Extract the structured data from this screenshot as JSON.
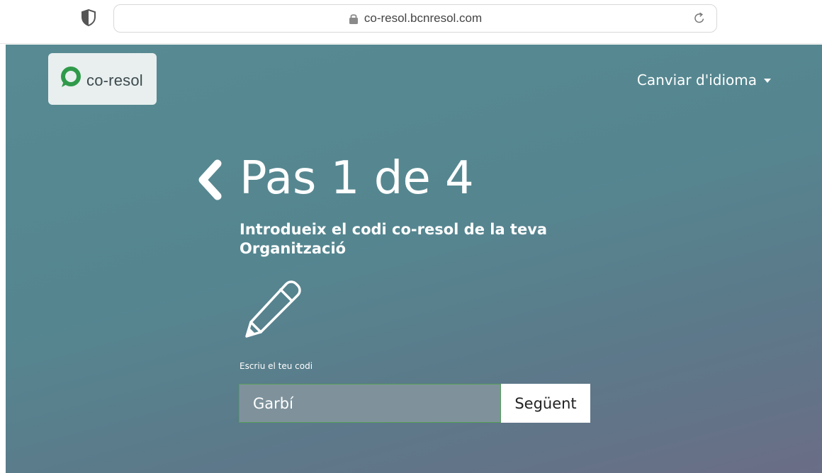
{
  "browser": {
    "url": "co-resol.bcnresol.com",
    "icons": {
      "shield": "shield-icon",
      "lock": "lock-icon",
      "reload": "reload-icon"
    }
  },
  "header": {
    "logo_text": "co-resol",
    "language_menu_label": "Canviar d'idioma"
  },
  "main": {
    "step_title": "Pas 1 de 4",
    "subtitle": "Introdueix el codi co-resol de la teva Organització",
    "field_label": "Escriu el teu codi",
    "code_value": "Garbí",
    "next_button": "Següent"
  },
  "colors": {
    "page_gradient_top": "#578a92",
    "page_gradient_bottom": "#6a6d86",
    "logo_green": "#2f9a4a",
    "input_border": "#54a056"
  }
}
